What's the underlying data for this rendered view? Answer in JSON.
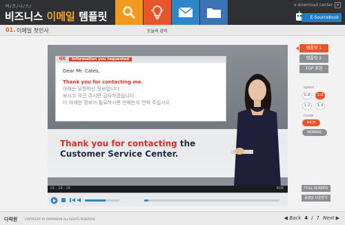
{
  "header": {
    "subtitle": "비/즈/니/스/",
    "title_main": "비즈니스",
    "title_accent": "이메일",
    "title_tail": "템플릿",
    "right_label": "e-download center",
    "esource_label": "E-Sourcebook"
  },
  "subheader": {
    "section_num": "01.",
    "section_title": "이메일 첫인사",
    "today_label": "오늘의 강의"
  },
  "email": {
    "subject_tag": "제목",
    "subject_text": "Information you requested",
    "greeting": "Dear Mr. Cates,",
    "line_en": "Thank you for contacting me.",
    "line_ko_1": "아래는 요청하신 정보입니다.",
    "line_ko_2": "보시고 의견 주시면 감사하겠습니다.",
    "line_ko_3": "더 자세한 정보가 필요하시면 언제든지 연락 주십시오."
  },
  "caption": {
    "highlight": "Thank you for contacting",
    "rest": " the Customer Service Center."
  },
  "controls": {
    "time_label": "01 : 18 : 16",
    "lang_label": "KOR"
  },
  "progress": {
    "fraction": 0.03
  },
  "volume": {
    "fraction": 0.6
  },
  "right_panel": {
    "buttons": [
      "템플릿 1",
      "템플릿 2",
      "TOP 표현"
    ],
    "active_index": 0,
    "speed_label": "speed",
    "speeds": [
      "0.8",
      "1.0",
      "1.2",
      "1.4"
    ],
    "active_speed": "1.0",
    "mode_label": "mode",
    "modes": [
      "RICH",
      "NORMAL"
    ],
    "active_mode": "RICH",
    "fullscreen_label": "FULL SCREEN",
    "download_label": "동영상 다운받기"
  },
  "footer": {
    "logo": "다락원",
    "copy": "COPYRIGHT BY DARAKWON ALL RIGHTS RESERVED",
    "back_label": "Back",
    "page_current": "4",
    "page_sep": "/",
    "page_total": "7",
    "next_label": "Next"
  },
  "colors": {
    "accent": "#e9542a",
    "orange": "#f39a1e",
    "blue": "#2b87c9",
    "dark": "#2f3033"
  }
}
